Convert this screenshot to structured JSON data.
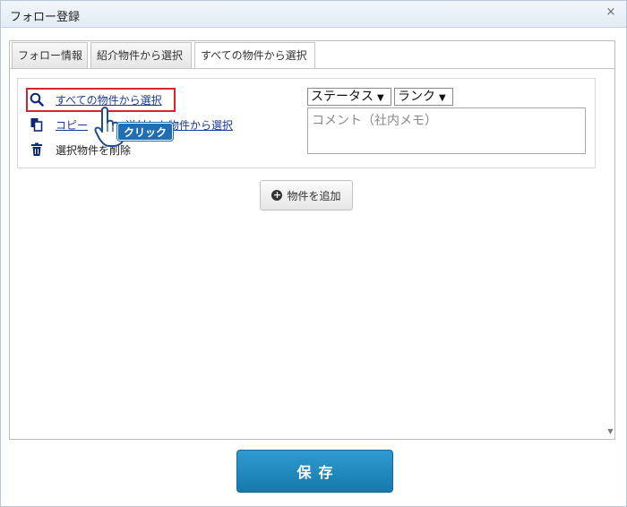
{
  "dialog": {
    "title": "フォロー登録",
    "close": "×"
  },
  "tabs": [
    {
      "label": "フォロー情報"
    },
    {
      "label": "紹介物件から選択"
    },
    {
      "label": "すべての物件から選択"
    }
  ],
  "actions": {
    "select_all": "すべての物件から選択",
    "copy_prefix": "コピー",
    "copy_suffix": "送付した物件から選択",
    "delete": "選択物件を削除"
  },
  "annotation": {
    "click_label": "クリック"
  },
  "selects": {
    "status": "ステータス",
    "rank": "ランク",
    "arrow": "▼"
  },
  "comment": {
    "placeholder": "コメント（社内メモ）"
  },
  "buttons": {
    "add_property": "物件を追加",
    "save": "保存"
  },
  "colors": {
    "highlight": "#d9212b",
    "save_button": "#1a86bf",
    "link": "#1a3a9a"
  }
}
